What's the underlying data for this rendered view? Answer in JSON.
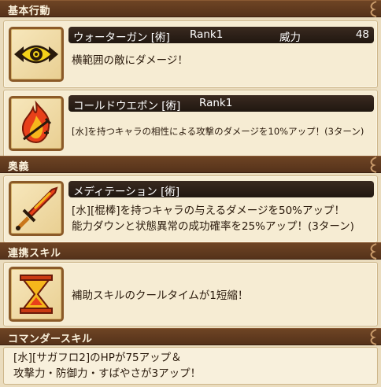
{
  "sections": {
    "basic": "基本行動",
    "ougi": "奥義",
    "renkei": "連携スキル",
    "commander": "コマンダースキル"
  },
  "skills": [
    {
      "name": "ウォーターガン [術]",
      "rank": "Rank1",
      "power_label": "威力",
      "power_value": "48",
      "description": "横範囲の敵にダメージ！",
      "icon": "water-gun-eye-icon"
    },
    {
      "name": "コールドウエポン [術]",
      "rank": "Rank1",
      "description": "[水]を持つキャラの相性による攻撃のダメージを10%アップ！(3ターン)",
      "icon": "cold-weapon-flame-icon"
    }
  ],
  "ougi": {
    "name": "メディテーション [術]",
    "description_line1": "[水][棍棒]を持つキャラの与えるダメージを50%アップ！",
    "description_line2": "能力ダウンと状態異常の成功確率を25%アップ！(3ターン)",
    "icon": "sword-icon"
  },
  "renkei": {
    "description": "補助スキルのクールタイムが1短縮！",
    "icon": "hourglass-icon"
  },
  "commander": {
    "line1": "[水][サガフロ2]のHPが75アップ＆",
    "line2": "攻撃力・防御力・すばやさが3アップ！"
  },
  "colors": {
    "section_bar": "#5f3a1f",
    "card_bg": "#f6ecd3",
    "title_bar": "#2a1e16",
    "icon_frame": "#8b5a28",
    "accent_red": "#d23a14",
    "accent_yellow": "#f2c21a"
  }
}
